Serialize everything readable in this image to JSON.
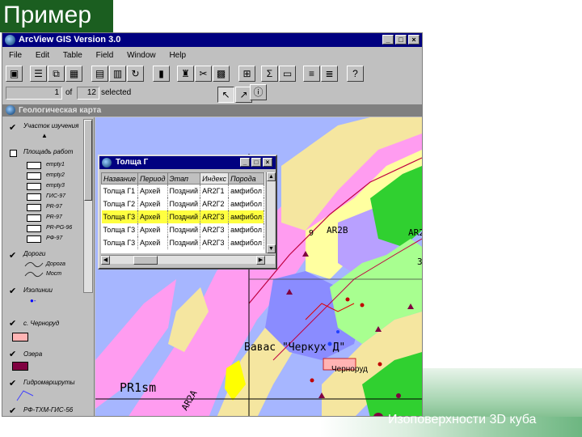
{
  "slide": {
    "title": "Пример",
    "caption": "Изоповерхности 3D куба",
    "accent": "#1b5e20"
  },
  "window": {
    "title": "ArcView GIS Version 3.0",
    "controls": [
      "_",
      "□",
      "×"
    ]
  },
  "menu": [
    "File",
    "Edit",
    "Table",
    "Field",
    "Window",
    "Help"
  ],
  "toolbar": {
    "record_index": "1",
    "record_of_label": "of",
    "selected_count": "12",
    "selected_label": "selected"
  },
  "view": {
    "title": "Геологическая карта"
  },
  "toc": {
    "items": [
      {
        "label": "Участок изучения",
        "checked": true
      },
      {
        "label": "Площадь работ",
        "checked": false
      },
      {
        "label": "Дороги",
        "checked": true
      },
      {
        "label": "Изолинии",
        "checked": true
      },
      {
        "label": "с. Черноруд",
        "checked": true
      },
      {
        "label": "Озера",
        "checked": true
      },
      {
        "label": "Гидромаршруты",
        "checked": true
      },
      {
        "label": "РФ-ТХМ-ГИС-56",
        "checked": true
      }
    ],
    "legend_work_area": [
      "empty1",
      "empty2",
      "empty3",
      "ГИС-97",
      "PR-97",
      "PR-97",
      "PR-PG-96",
      "РФ-97"
    ],
    "legend_roads": [
      "Дорога",
      "Мост"
    ]
  },
  "table": {
    "title": "Толща Г",
    "columns": [
      "Название",
      "Период",
      "Этап",
      "Индекс",
      "Порода"
    ],
    "rows": [
      [
        "Толща Г1",
        "Архей",
        "Поздний",
        "AR2Г1",
        "амфибол"
      ],
      [
        "Толща Г2",
        "Архей",
        "Поздний",
        "AR2Г2",
        "амфибол"
      ],
      [
        "Толща Г3",
        "Архей",
        "Поздний",
        "AR2Г3",
        "амфибол"
      ],
      [
        "Толща Г3",
        "Архей",
        "Поздний",
        "AR2Г3",
        "амфибол"
      ],
      [
        "Толща Г3",
        "Архей",
        "Поздний",
        "AR2Г3",
        "амфибол"
      ]
    ],
    "highlighted_row": 2
  },
  "map_labels": {
    "ar2b": "AR2B",
    "ar2": "AR2",
    "village_label": "Вавас \"Черкух Д\"",
    "village_name": "Черноруд",
    "pr1sm": "PR1sm",
    "ar2a": "AR2A",
    "num_3": "3",
    "num_9": "9"
  }
}
